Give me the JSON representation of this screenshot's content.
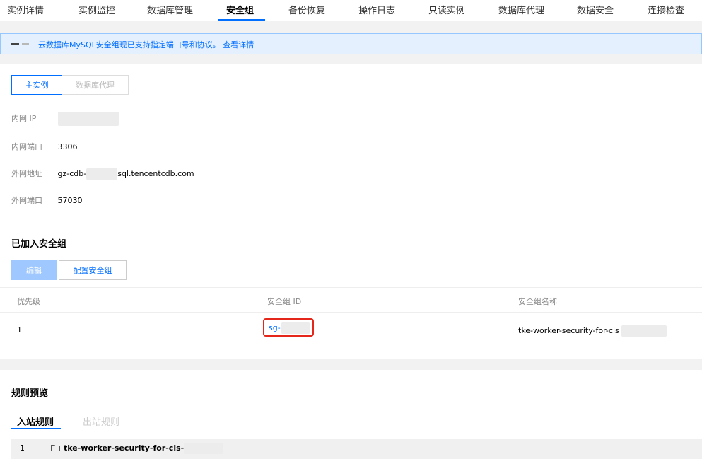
{
  "tabs": [
    {
      "label": "实例详情",
      "active": false
    },
    {
      "label": "实例监控",
      "active": false
    },
    {
      "label": "数据库管理",
      "active": false
    },
    {
      "label": "安全组",
      "active": true
    },
    {
      "label": "备份恢复",
      "active": false
    },
    {
      "label": "操作日志",
      "active": false
    },
    {
      "label": "只读实例",
      "active": false
    },
    {
      "label": "数据库代理",
      "active": false
    },
    {
      "label": "数据安全",
      "active": false
    },
    {
      "label": "连接检查",
      "active": false
    }
  ],
  "notice": {
    "text": "云数据库MySQL安全组现已支持指定端口号和协议。",
    "link": "查看详情"
  },
  "instance_switch": {
    "primary": "主实例",
    "proxy": "数据库代理"
  },
  "network_info": [
    {
      "key": "内网 IP",
      "value": ""
    },
    {
      "key": "内网端口",
      "value": "3306"
    },
    {
      "key": "外网地址",
      "value_prefix": "gz-cdb-",
      "value_suffix": "sql.tencentcdb.com"
    },
    {
      "key": "外网端口",
      "value": "57030"
    }
  ],
  "joined_groups": {
    "title": "已加入安全组",
    "edit_label": "编辑",
    "config_label": "配置安全组",
    "columns": [
      "优先级",
      "安全组 ID",
      "安全组名称"
    ],
    "rows": [
      {
        "priority": "1",
        "id": "sg-",
        "name": "tke-worker-security-for-cls"
      }
    ]
  },
  "rules_preview": {
    "title": "规则预览",
    "tabs": [
      "入站规则",
      "出站规则"
    ],
    "rows": [
      {
        "index": "1",
        "name": "tke-worker-security-for-cls-"
      }
    ]
  },
  "colors": {
    "accent": "#006eff",
    "highlight": "#e5261b",
    "notice_bg": "#e5f0ff"
  }
}
